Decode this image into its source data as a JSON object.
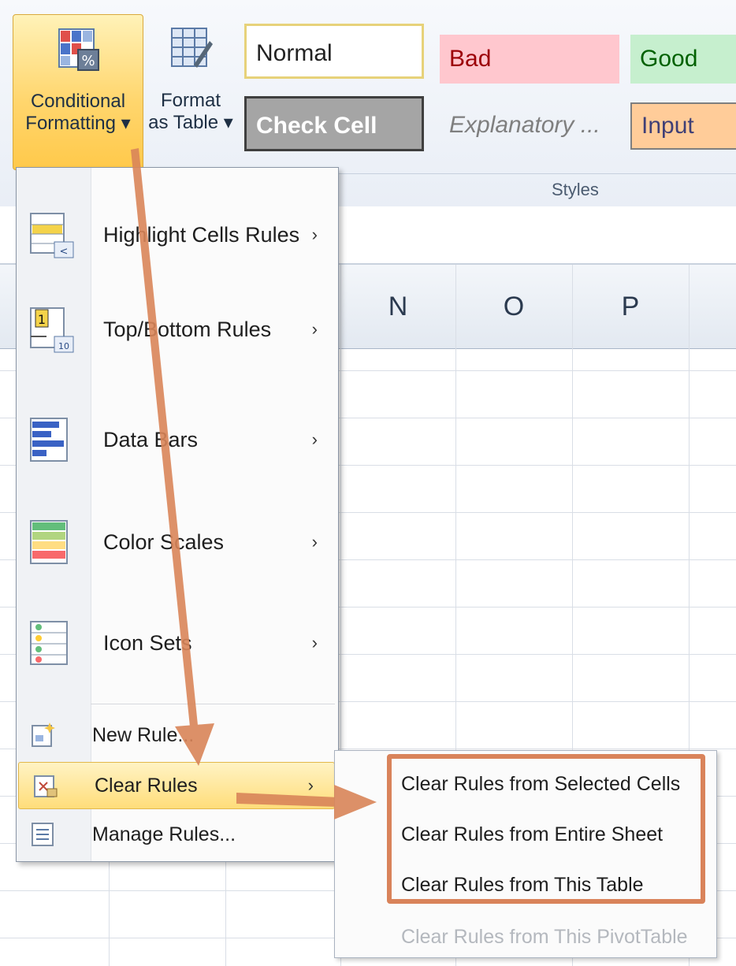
{
  "ribbon": {
    "conditional_formatting": {
      "line1": "Conditional",
      "line2": "Formatting ▾"
    },
    "format_as_table": {
      "line1": "Format",
      "line2": "as Table ▾"
    },
    "styles": {
      "normal": "Normal",
      "bad": "Bad",
      "good": "Good",
      "check_cell": "Check Cell",
      "explanatory": "Explanatory ...",
      "input": "Input"
    },
    "group_label": "Styles"
  },
  "columns": [
    "N",
    "O",
    "P"
  ],
  "menu": {
    "items": [
      {
        "label": "Highlight Cells Rules",
        "icon": "highlight-cells-icon"
      },
      {
        "label": "Top/Bottom Rules",
        "icon": "top-bottom-icon"
      },
      {
        "label": "Data Bars",
        "icon": "data-bars-icon"
      },
      {
        "label": "Color Scales",
        "icon": "color-scales-icon"
      },
      {
        "label": "Icon Sets",
        "icon": "icon-sets-icon"
      },
      {
        "label": "New Rule...",
        "icon": "new-rule-icon"
      },
      {
        "label": "Clear Rules",
        "icon": "clear-rules-icon"
      },
      {
        "label": "Manage Rules...",
        "icon": "manage-rules-icon"
      }
    ],
    "submenu_arrow": "›"
  },
  "submenu": {
    "items": [
      {
        "label": "Clear Rules from Selected Cells",
        "enabled": true
      },
      {
        "label": "Clear Rules from Entire Sheet",
        "enabled": true
      },
      {
        "label": "Clear Rules from This Table",
        "enabled": true
      },
      {
        "label": "Clear Rules from This PivotTable",
        "enabled": false
      }
    ]
  },
  "colors": {
    "highlight_border": "#d9835a",
    "annotation_arrow": "#d98559",
    "hover_fill": "#ffdd7a"
  }
}
